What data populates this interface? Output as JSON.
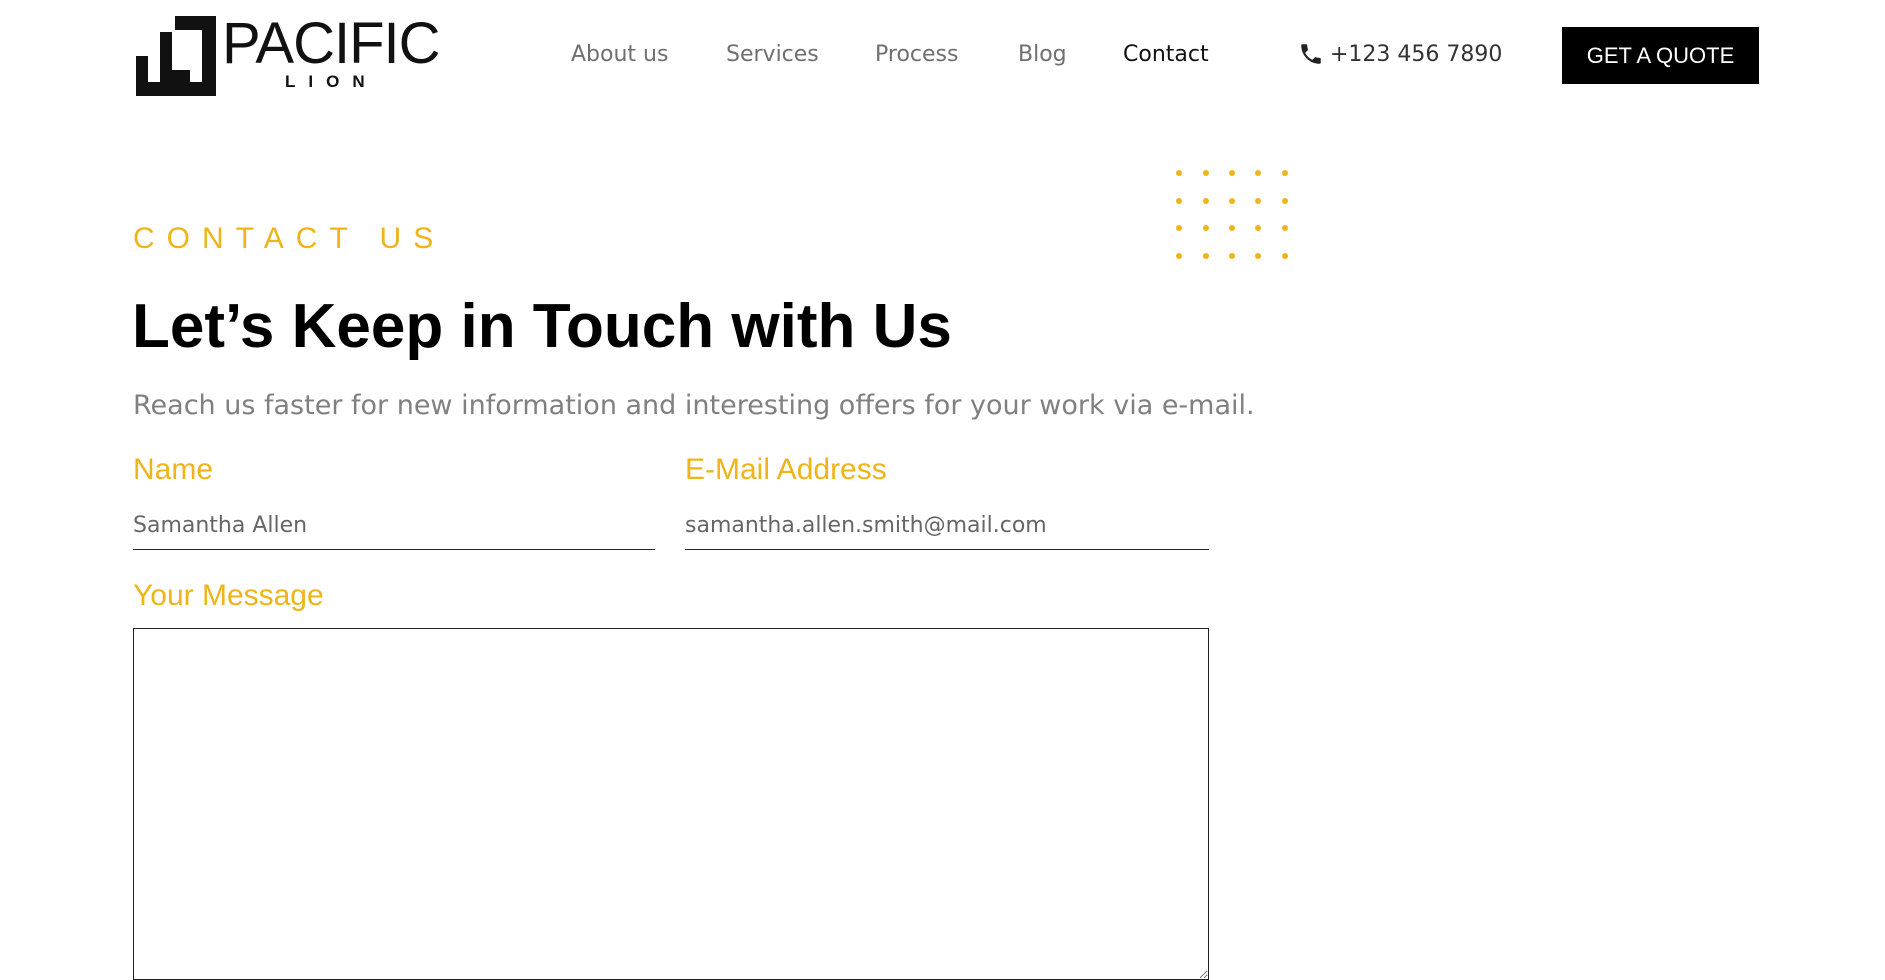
{
  "brand": {
    "name": "PACIFIC",
    "tagline": "LION"
  },
  "nav": {
    "items": [
      {
        "label": "About us",
        "active": false
      },
      {
        "label": "Services",
        "active": false
      },
      {
        "label": "Process",
        "active": false
      },
      {
        "label": "Blog",
        "active": false
      },
      {
        "label": "Contact",
        "active": true
      }
    ]
  },
  "header": {
    "phone": "+123 456 7890",
    "phone_icon": "phone-icon",
    "cta_label": "GET A QUOTE"
  },
  "contact": {
    "eyebrow": "CONTACT US",
    "title": "Let’s Keep in Touch with Us",
    "description": "Reach us faster for new information and interesting offers for your work via e-mail."
  },
  "form": {
    "name_label": "Name",
    "name_value": "Samantha Allen",
    "email_label": "E-Mail Address",
    "email_value": "samantha.allen.smith@mail.com",
    "message_label": "Your Message",
    "message_value": ""
  },
  "colors": {
    "accent": "#f0b418",
    "text_dark": "#000000",
    "text_muted": "#808080",
    "button_bg": "#000000"
  }
}
